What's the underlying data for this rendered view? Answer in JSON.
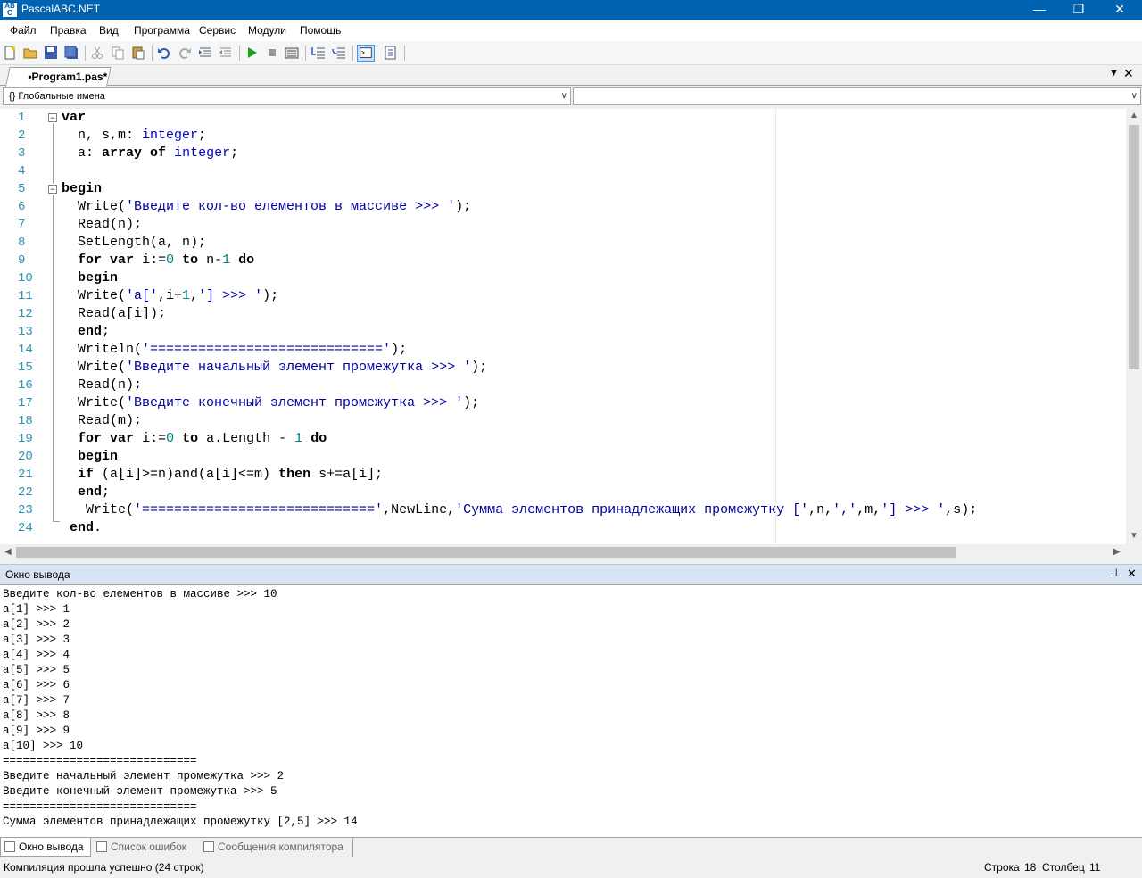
{
  "window": {
    "title": "PascalABC.NET",
    "minimize": "—",
    "maximize": "❐",
    "close": "✕"
  },
  "menu": [
    "Файл",
    "Правка",
    "Вид",
    "Программа",
    "Сервис",
    "Модули",
    "Помощь"
  ],
  "editor_tab": {
    "label": "•Program1.pas*"
  },
  "scope_combo": {
    "value": "{} Глобальные имена"
  },
  "member_combo": {
    "value": ""
  },
  "code": {
    "line_numbers": [
      "1",
      "2",
      "3",
      "4",
      "5",
      "6",
      "7",
      "8",
      "9",
      "10",
      "11",
      "12",
      "13",
      "14",
      "15",
      "16",
      "17",
      "18",
      "19",
      "20",
      "21",
      "22",
      "23",
      "24"
    ],
    "lines": [
      "var",
      "  n, s,m: integer;",
      "  a: array of integer;",
      "",
      "begin",
      "  Write('Введите кол-во елементов в массиве >>> ');",
      "  Read(n);",
      "  SetLength(a, n);",
      "  for var i:=0 to n-1 do",
      "  begin",
      "  Write('a[',i+1,'] >>> ');",
      "  Read(a[i]);",
      "  end;",
      "  Writeln('=============================');",
      "  Write('Введите начальный элемент промежутка >>> ');",
      "  Read(n);",
      "  Write('Введите конечный элемент промежутка >>> ');",
      "  Read(m);",
      "  for var i:=0 to a.Length - 1 do",
      "  begin",
      "  if (a[i]>=n)and(a[i]<=m) then s+=a[i];",
      "  end;",
      "   Write('=============================',NewLine,'Сумма элементов принадлежащих промежутку [',n,',',m,'] >>> ',s);",
      " end."
    ]
  },
  "output_panel": {
    "title": "Окно вывода",
    "pin": "⊥",
    "close": "✕",
    "lines": [
      "Введите кол-во елементов в массиве >>> 10",
      "a[1] >>> 1",
      "a[2] >>> 2",
      "a[3] >>> 3",
      "a[4] >>> 4",
      "a[5] >>> 5",
      "a[6] >>> 6",
      "a[7] >>> 7",
      "a[8] >>> 8",
      "a[9] >>> 9",
      "a[10] >>> 10",
      "=============================",
      "Введите начальный элемент промежутка >>> 2",
      "Введите конечный элемент промежутка >>> 5",
      "=============================",
      "Сумма элементов принадлежащих промежутку [2,5] >>> 14"
    ]
  },
  "bottom_tabs": [
    "Окно вывода",
    "Список ошибок",
    "Сообщения компилятора"
  ],
  "status": {
    "message": "Компиляция прошла успешно (24 строк)",
    "row_label": "Строка",
    "row_value": "18",
    "col_label": "Столбец",
    "col_value": "11"
  },
  "colors": {
    "titlebar": "#0063b1",
    "keyword": "#000000",
    "type": "#0000cd",
    "string": "#0000a0",
    "number": "#008080",
    "line_number": "#2b91af"
  },
  "toolbar_icons": [
    "new-file-icon",
    "open-icon",
    "save-icon",
    "save-all-icon",
    "cut-icon",
    "copy-icon",
    "paste-icon",
    "undo-icon",
    "redo-icon",
    "indent-icon",
    "unindent-icon",
    "run-icon",
    "stop-icon",
    "compile-icon",
    "step-into-icon",
    "step-over-icon",
    "toggle-output-icon",
    "debug-icon"
  ]
}
